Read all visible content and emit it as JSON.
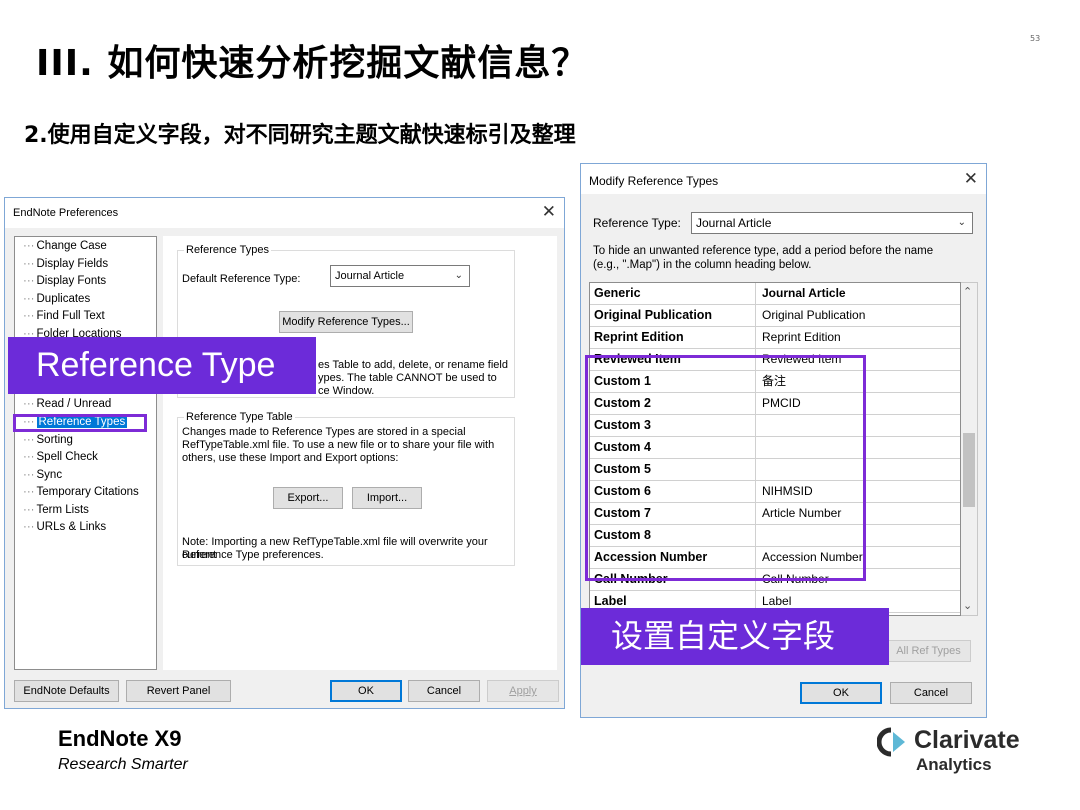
{
  "slide": {
    "title": "III. 如何快速分析挖掘文献信息？",
    "page_number": "53",
    "subtitle": "2.使用自定义字段，对不同研究主题文献快速标引及整理"
  },
  "preferences": {
    "window_title": "EndNote Preferences",
    "close_glyph": "✕",
    "tree": [
      {
        "label": "Change Case"
      },
      {
        "label": "Display Fields"
      },
      {
        "label": "Display Fonts"
      },
      {
        "label": "Duplicates"
      },
      {
        "label": "Find Full Text"
      },
      {
        "label": "Folder Locations"
      },
      {
        "label": "Read / Unread"
      },
      {
        "label": "Reference Types"
      },
      {
        "label": "Sorting"
      },
      {
        "label": "Spell Check"
      },
      {
        "label": "Sync"
      },
      {
        "label": "Temporary Citations"
      },
      {
        "label": "Term Lists"
      },
      {
        "label": "URLs & Links"
      }
    ],
    "group1_legend": "Reference Types",
    "default_type_label": "Default Reference Type:",
    "default_type_value": "Journal Article",
    "modify_button": "Modify Reference Types...",
    "desc_line1": "es Table to add, delete, or rename field",
    "desc_line2": "ypes.  The table CANNOT be used to",
    "desc_line3": "ce Window.",
    "group2_legend": "Reference Type Table",
    "table_desc_1": "Changes made to Reference Types are stored in a special",
    "table_desc_2": "RefTypeTable.xml file.  To use a new file or to share your file with",
    "table_desc_3": "others, use these Import and Export options:",
    "export_button": "Export...",
    "import_button": "Import...",
    "note_1": "Note: Importing a new RefTypeTable.xml file will overwrite your current",
    "note_2": "Reference Type preferences.",
    "defaults_button": "EndNote Defaults",
    "revert_button": "Revert Panel",
    "ok_button": "OK",
    "cancel_button": "Cancel",
    "apply_button": "Apply"
  },
  "reference_banner": "Reference Type",
  "modify": {
    "window_title": "Modify Reference Types",
    "close_glyph": "✕",
    "ref_type_label": "Reference Type:",
    "ref_type_value": "Journal Article",
    "hint_1": "To hide an unwanted reference type, add a period before the name",
    "hint_2": "(e.g., \".Map\") in the column heading below.",
    "rows": [
      {
        "field": "Generic",
        "value": "Journal Article"
      },
      {
        "field": "Original Publication",
        "value": "Original Publication"
      },
      {
        "field": "Reprint Edition",
        "value": "Reprint Edition"
      },
      {
        "field": "Reviewed Item",
        "value": "Reviewed Item"
      },
      {
        "field": "Custom 1",
        "value": "备注"
      },
      {
        "field": "Custom 2",
        "value": "PMCID"
      },
      {
        "field": "Custom 3",
        "value": ""
      },
      {
        "field": "Custom 4",
        "value": ""
      },
      {
        "field": "Custom 5",
        "value": ""
      },
      {
        "field": "Custom 6",
        "value": "NIHMSID"
      },
      {
        "field": "Custom 7",
        "value": "Article Number"
      },
      {
        "field": "Custom 8",
        "value": ""
      },
      {
        "field": "Accession Number",
        "value": "Accession Number"
      },
      {
        "field": "Call Number",
        "value": "Call Number"
      },
      {
        "field": "Label",
        "value": "Label"
      }
    ],
    "all_ref_types_button": "All Ref Types",
    "ok_button": "OK",
    "cancel_button": "Cancel"
  },
  "custom_banner": "设置自定义字段",
  "footer": {
    "brand": "EndNote X9",
    "tagline": "Research Smarter",
    "logo_name": "Clarivate",
    "logo_sub": "Analytics"
  },
  "colors": {
    "highlight_purple": "#6c2bd9",
    "selection_blue": "#0078d7"
  }
}
